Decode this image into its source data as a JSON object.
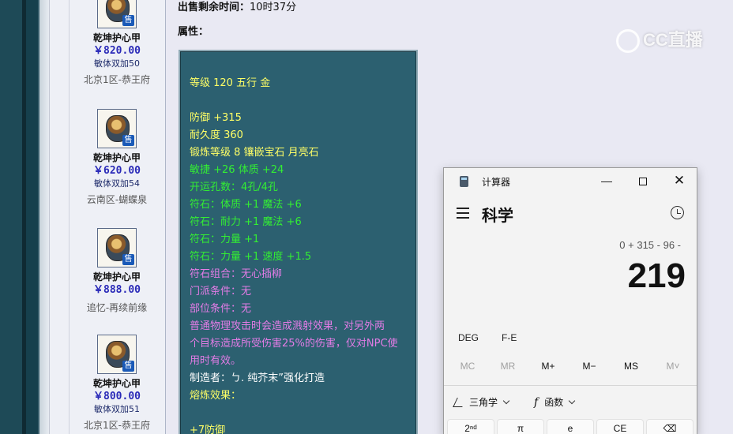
{
  "listing": {
    "items": [
      {
        "name": "乾坤护心甲",
        "price": "￥820.00",
        "tag": "敏体双加50",
        "server": "北京1区-恭王府",
        "badge": "售"
      },
      {
        "name": "乾坤护心甲",
        "price": "￥620.00",
        "tag": "敏体双加54",
        "server": "云南区-蝴蝶泉",
        "badge": "售"
      },
      {
        "name": "乾坤护心甲",
        "price": "￥888.00",
        "tag": "",
        "server": "追忆-再续前缘",
        "badge": "售"
      },
      {
        "name": "乾坤护心甲",
        "price": "￥800.00",
        "tag": "敏体双加51",
        "server": "北京1区-恭王府",
        "badge": "售"
      }
    ]
  },
  "detail": {
    "timer_label": "出售剩余时间：",
    "timer_value": "10时37分",
    "attr_label": "属性：",
    "attributes": [
      {
        "text": "等级 120 五行 金",
        "color": "yellow"
      },
      {
        "text": "",
        "color": "yellow"
      },
      {
        "text": "防御 +315",
        "color": "yellow"
      },
      {
        "text": "耐久度 360",
        "color": "yellow"
      },
      {
        "text": "锻炼等级 8 镶嵌宝石 月亮石",
        "color": "yellow"
      },
      {
        "text": "敏捷 +26 体质 +24",
        "color": "green"
      },
      {
        "text": "开运孔数：4孔/4孔",
        "color": "green"
      },
      {
        "text": "符石：体质 +1 魔法 +6",
        "color": "green"
      },
      {
        "text": "符石：耐力 +1 魔法 +6",
        "color": "green"
      },
      {
        "text": "符石：力量 +1",
        "color": "green"
      },
      {
        "text": "符石：力量 +1 速度 +1.5",
        "color": "green"
      },
      {
        "text": "符石组合：无心插柳",
        "color": "purple"
      },
      {
        "text": "门派条件：无",
        "color": "purple"
      },
      {
        "text": "部位条件：无",
        "color": "purple"
      },
      {
        "text": "普通物理攻击时会造成溅射效果，对另外两",
        "color": "purple"
      },
      {
        "text": "个目标造成所受伤害25%的伤害，仅对NPC使",
        "color": "purple"
      },
      {
        "text": "用时有效。",
        "color": "purple"
      },
      {
        "text": "制造者：ㄅ. 纯芥末”强化打造",
        "color": "white"
      },
      {
        "text": "熔炼效果：",
        "color": "yellow"
      },
      {
        "text": "",
        "color": "yellow"
      },
      {
        "text": "+7防御",
        "color": "yellow"
      }
    ]
  },
  "watermark": {
    "text": "CC直播"
  },
  "calculator": {
    "app_title": "计算器",
    "mode": "科学",
    "expression": "0 + 315 - 96 -",
    "display": "219",
    "angle_unit": "DEG",
    "fe_label": "F-E",
    "memory": [
      "MC",
      "MR",
      "M+",
      "M−",
      "MS",
      "M˅"
    ],
    "trig_label": "三角学",
    "func_label": "函数",
    "keys": [
      "2ⁿᵈ",
      "π",
      "e",
      "CE",
      "⌫"
    ],
    "window_buttons": {
      "minimize": "—",
      "maximize": "□",
      "close": "✕"
    }
  },
  "colors": {
    "yellow": "#ffff66",
    "green": "#33ee33",
    "purple": "#e37ce6",
    "white": "#ffffff",
    "attr_bg": "#2c6070",
    "price": "#2a2ab8"
  }
}
